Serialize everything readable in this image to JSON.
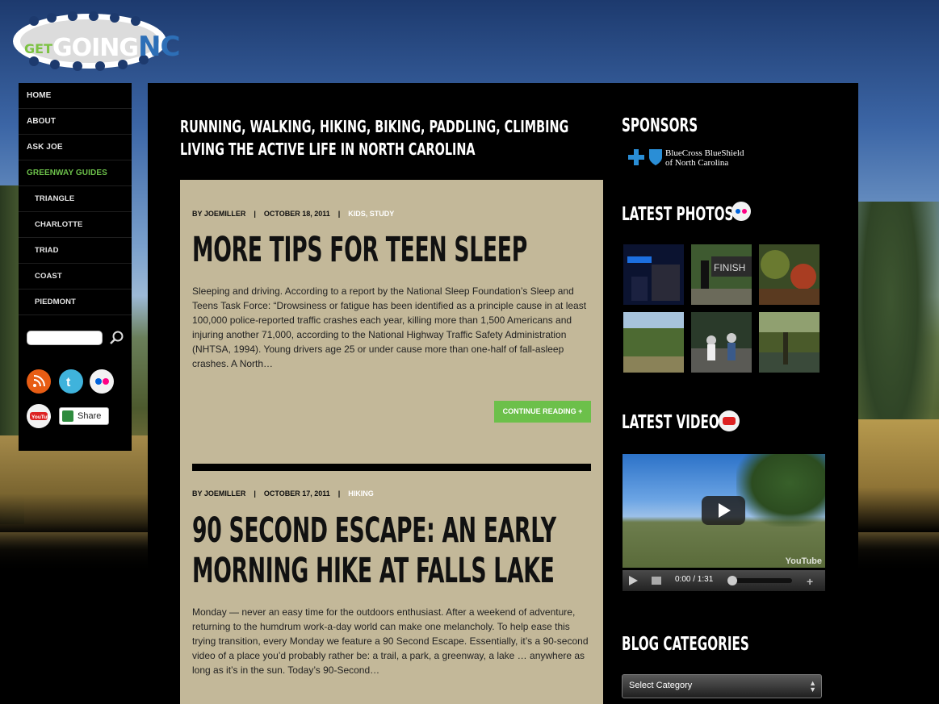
{
  "logo": {
    "get": "GET",
    "going": "GOING",
    "nc": "NC"
  },
  "nav": {
    "items": [
      {
        "label": "HOME"
      },
      {
        "label": "ABOUT"
      },
      {
        "label": "ASK JOE"
      },
      {
        "label": "GREENWAY GUIDES"
      },
      {
        "label": "TRIANGLE"
      },
      {
        "label": "CHARLOTTE"
      },
      {
        "label": "TRIAD"
      },
      {
        "label": "COAST"
      },
      {
        "label": "PIEDMONT"
      }
    ]
  },
  "search": {
    "value": "",
    "placeholder": ""
  },
  "social": {
    "share_label": "Share",
    "icons": [
      "rss-icon",
      "twitter-icon",
      "flickr-icon",
      "youtube-icon"
    ]
  },
  "tagline": {
    "line1": "RUNNING, WALKING, HIKING, BIKING, PADDLING, CLIMBING",
    "line2": "LIVING THE ACTIVE LIFE IN NORTH CAROLINA"
  },
  "posts": [
    {
      "author": "BY JOEMILLER",
      "sep": "|",
      "date": "OCTOBER 18, 2011",
      "categories": "KIDS, STUDY",
      "title": "MORE TIPS FOR TEEN SLEEP",
      "excerpt": "Sleeping and driving. According to a report by the National Sleep Foundation’s Sleep and Teens Task Force: “Drowsiness or fatigue has been identified as a principle cause in at least 100,000 police-reported traffic crashes each year, killing more than 1,500 Americans and injuring another 71,000, according to the National Highway Traffic Safety Administration (NHTSA, 1994). Young drivers age 25 or under cause more than one-half of fall-asleep crashes.  A North…",
      "continue": "CONTINUE READING +"
    },
    {
      "author": "BY JOEMILLER",
      "sep": "|",
      "date": "OCTOBER 17, 2011",
      "categories": "HIKING",
      "title_line1": "90 SECOND ESCAPE: AN EARLY",
      "title_line2": "MORNING HIKE AT FALLS LAKE",
      "excerpt": "Monday — never an easy time for the outdoors enthusiast. After a weekend of adventure, returning to the humdrum work-a-day world can make one melancholy. To help ease this trying transition, every Monday we feature a 90 Second Escape. Essentially, it’s a 90-second video of a place you’d probably rather be: a trail, a park, a greenway, a lake … anywhere as long as it’s in the sun. Today’s 90-Second…"
    }
  ],
  "sidebar": {
    "sponsors_heading": "SPONSORS",
    "sponsor_name_line1": "BlueCross BlueShield",
    "sponsor_name_line2": "of North Carolina",
    "photos_heading": "LATEST PHOTOS",
    "video_heading": "LATEST VIDEO",
    "video_time": "0:00 / 1:31",
    "video_brand": "YouTube",
    "categories_heading": "BLOG CATEGORIES",
    "category_select": "Select Category"
  },
  "colors": {
    "accent_green": "#6cc04a",
    "post_bg": "#c3b899",
    "brand_blue": "#2d6fb7"
  }
}
